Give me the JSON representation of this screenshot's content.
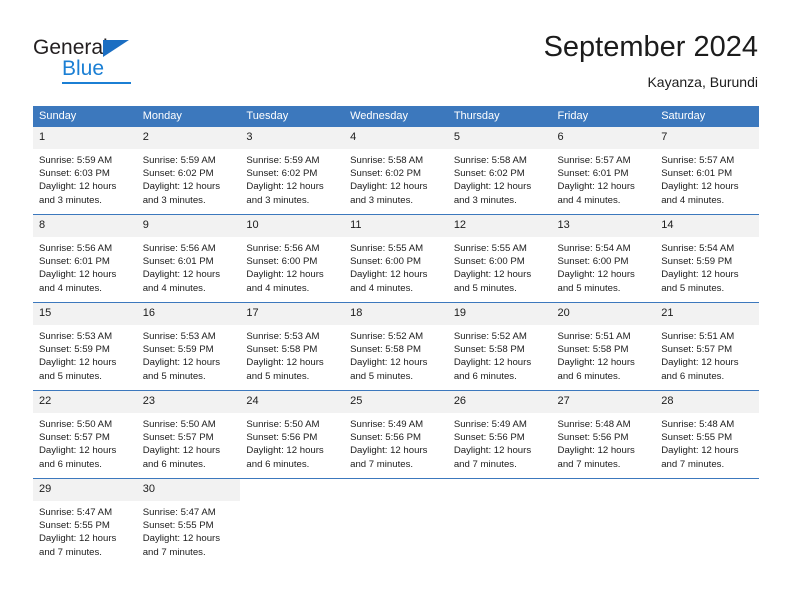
{
  "brand": {
    "name_part1": "General",
    "name_part2": "Blue",
    "triangle_color": "#1b6ec2",
    "blue_color": "#1b7fd4"
  },
  "header": {
    "title": "September 2024",
    "subtitle": "Kayanza, Burundi"
  },
  "theme": {
    "header_row_bg": "#3c78bd",
    "header_row_text": "#ffffff",
    "day_number_bg": "#f2f2f2",
    "row_divider": "#3c78bd",
    "body_text": "#1c1c1c"
  },
  "weekday_headers": [
    "Sunday",
    "Monday",
    "Tuesday",
    "Wednesday",
    "Thursday",
    "Friday",
    "Saturday"
  ],
  "labels": {
    "sunrise_prefix": "Sunrise:",
    "sunset_prefix": "Sunset:",
    "daylight_prefix": "Daylight:"
  },
  "weeks": [
    [
      {
        "day": "1",
        "sunrise": "Sunrise: 5:59 AM",
        "sunset": "Sunset: 6:03 PM",
        "daylight_line1": "Daylight: 12 hours",
        "daylight_line2": "and 3 minutes."
      },
      {
        "day": "2",
        "sunrise": "Sunrise: 5:59 AM",
        "sunset": "Sunset: 6:02 PM",
        "daylight_line1": "Daylight: 12 hours",
        "daylight_line2": "and 3 minutes."
      },
      {
        "day": "3",
        "sunrise": "Sunrise: 5:59 AM",
        "sunset": "Sunset: 6:02 PM",
        "daylight_line1": "Daylight: 12 hours",
        "daylight_line2": "and 3 minutes."
      },
      {
        "day": "4",
        "sunrise": "Sunrise: 5:58 AM",
        "sunset": "Sunset: 6:02 PM",
        "daylight_line1": "Daylight: 12 hours",
        "daylight_line2": "and 3 minutes."
      },
      {
        "day": "5",
        "sunrise": "Sunrise: 5:58 AM",
        "sunset": "Sunset: 6:02 PM",
        "daylight_line1": "Daylight: 12 hours",
        "daylight_line2": "and 3 minutes."
      },
      {
        "day": "6",
        "sunrise": "Sunrise: 5:57 AM",
        "sunset": "Sunset: 6:01 PM",
        "daylight_line1": "Daylight: 12 hours",
        "daylight_line2": "and 4 minutes."
      },
      {
        "day": "7",
        "sunrise": "Sunrise: 5:57 AM",
        "sunset": "Sunset: 6:01 PM",
        "daylight_line1": "Daylight: 12 hours",
        "daylight_line2": "and 4 minutes."
      }
    ],
    [
      {
        "day": "8",
        "sunrise": "Sunrise: 5:56 AM",
        "sunset": "Sunset: 6:01 PM",
        "daylight_line1": "Daylight: 12 hours",
        "daylight_line2": "and 4 minutes."
      },
      {
        "day": "9",
        "sunrise": "Sunrise: 5:56 AM",
        "sunset": "Sunset: 6:01 PM",
        "daylight_line1": "Daylight: 12 hours",
        "daylight_line2": "and 4 minutes."
      },
      {
        "day": "10",
        "sunrise": "Sunrise: 5:56 AM",
        "sunset": "Sunset: 6:00 PM",
        "daylight_line1": "Daylight: 12 hours",
        "daylight_line2": "and 4 minutes."
      },
      {
        "day": "11",
        "sunrise": "Sunrise: 5:55 AM",
        "sunset": "Sunset: 6:00 PM",
        "daylight_line1": "Daylight: 12 hours",
        "daylight_line2": "and 4 minutes."
      },
      {
        "day": "12",
        "sunrise": "Sunrise: 5:55 AM",
        "sunset": "Sunset: 6:00 PM",
        "daylight_line1": "Daylight: 12 hours",
        "daylight_line2": "and 5 minutes."
      },
      {
        "day": "13",
        "sunrise": "Sunrise: 5:54 AM",
        "sunset": "Sunset: 6:00 PM",
        "daylight_line1": "Daylight: 12 hours",
        "daylight_line2": "and 5 minutes."
      },
      {
        "day": "14",
        "sunrise": "Sunrise: 5:54 AM",
        "sunset": "Sunset: 5:59 PM",
        "daylight_line1": "Daylight: 12 hours",
        "daylight_line2": "and 5 minutes."
      }
    ],
    [
      {
        "day": "15",
        "sunrise": "Sunrise: 5:53 AM",
        "sunset": "Sunset: 5:59 PM",
        "daylight_line1": "Daylight: 12 hours",
        "daylight_line2": "and 5 minutes."
      },
      {
        "day": "16",
        "sunrise": "Sunrise: 5:53 AM",
        "sunset": "Sunset: 5:59 PM",
        "daylight_line1": "Daylight: 12 hours",
        "daylight_line2": "and 5 minutes."
      },
      {
        "day": "17",
        "sunrise": "Sunrise: 5:53 AM",
        "sunset": "Sunset: 5:58 PM",
        "daylight_line1": "Daylight: 12 hours",
        "daylight_line2": "and 5 minutes."
      },
      {
        "day": "18",
        "sunrise": "Sunrise: 5:52 AM",
        "sunset": "Sunset: 5:58 PM",
        "daylight_line1": "Daylight: 12 hours",
        "daylight_line2": "and 5 minutes."
      },
      {
        "day": "19",
        "sunrise": "Sunrise: 5:52 AM",
        "sunset": "Sunset: 5:58 PM",
        "daylight_line1": "Daylight: 12 hours",
        "daylight_line2": "and 6 minutes."
      },
      {
        "day": "20",
        "sunrise": "Sunrise: 5:51 AM",
        "sunset": "Sunset: 5:58 PM",
        "daylight_line1": "Daylight: 12 hours",
        "daylight_line2": "and 6 minutes."
      },
      {
        "day": "21",
        "sunrise": "Sunrise: 5:51 AM",
        "sunset": "Sunset: 5:57 PM",
        "daylight_line1": "Daylight: 12 hours",
        "daylight_line2": "and 6 minutes."
      }
    ],
    [
      {
        "day": "22",
        "sunrise": "Sunrise: 5:50 AM",
        "sunset": "Sunset: 5:57 PM",
        "daylight_line1": "Daylight: 12 hours",
        "daylight_line2": "and 6 minutes."
      },
      {
        "day": "23",
        "sunrise": "Sunrise: 5:50 AM",
        "sunset": "Sunset: 5:57 PM",
        "daylight_line1": "Daylight: 12 hours",
        "daylight_line2": "and 6 minutes."
      },
      {
        "day": "24",
        "sunrise": "Sunrise: 5:50 AM",
        "sunset": "Sunset: 5:56 PM",
        "daylight_line1": "Daylight: 12 hours",
        "daylight_line2": "and 6 minutes."
      },
      {
        "day": "25",
        "sunrise": "Sunrise: 5:49 AM",
        "sunset": "Sunset: 5:56 PM",
        "daylight_line1": "Daylight: 12 hours",
        "daylight_line2": "and 7 minutes."
      },
      {
        "day": "26",
        "sunrise": "Sunrise: 5:49 AM",
        "sunset": "Sunset: 5:56 PM",
        "daylight_line1": "Daylight: 12 hours",
        "daylight_line2": "and 7 minutes."
      },
      {
        "day": "27",
        "sunrise": "Sunrise: 5:48 AM",
        "sunset": "Sunset: 5:56 PM",
        "daylight_line1": "Daylight: 12 hours",
        "daylight_line2": "and 7 minutes."
      },
      {
        "day": "28",
        "sunrise": "Sunrise: 5:48 AM",
        "sunset": "Sunset: 5:55 PM",
        "daylight_line1": "Daylight: 12 hours",
        "daylight_line2": "and 7 minutes."
      }
    ],
    [
      {
        "day": "29",
        "sunrise": "Sunrise: 5:47 AM",
        "sunset": "Sunset: 5:55 PM",
        "daylight_line1": "Daylight: 12 hours",
        "daylight_line2": "and 7 minutes."
      },
      {
        "day": "30",
        "sunrise": "Sunrise: 5:47 AM",
        "sunset": "Sunset: 5:55 PM",
        "daylight_line1": "Daylight: 12 hours",
        "daylight_line2": "and 7 minutes."
      },
      {
        "day": "",
        "sunrise": "",
        "sunset": "",
        "daylight_line1": "",
        "daylight_line2": ""
      },
      {
        "day": "",
        "sunrise": "",
        "sunset": "",
        "daylight_line1": "",
        "daylight_line2": ""
      },
      {
        "day": "",
        "sunrise": "",
        "sunset": "",
        "daylight_line1": "",
        "daylight_line2": ""
      },
      {
        "day": "",
        "sunrise": "",
        "sunset": "",
        "daylight_line1": "",
        "daylight_line2": ""
      },
      {
        "day": "",
        "sunrise": "",
        "sunset": "",
        "daylight_line1": "",
        "daylight_line2": ""
      }
    ]
  ]
}
